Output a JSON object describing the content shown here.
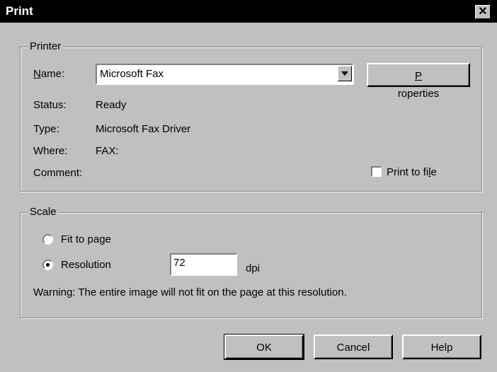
{
  "dialog": {
    "title": "Print",
    "close_glyph": "✕"
  },
  "printer_group": {
    "legend": "Printer",
    "name_label_accel": "N",
    "name_label_rest": "ame:",
    "name_value": "Microsoft Fax",
    "properties_label_accel": "P",
    "properties_label_rest": "roperties",
    "status_label": "Status:",
    "status_value": "Ready",
    "type_label": "Type:",
    "type_value": "Microsoft Fax Driver",
    "where_label": "Where:",
    "where_value": "FAX:",
    "comment_label": "Comment:",
    "print_to_file_pre": "Print to fi",
    "print_to_file_accel": "l",
    "print_to_file_post": "e",
    "print_to_file_checked": false
  },
  "scale_group": {
    "legend": "Scale",
    "fit_to_page_label": "Fit to page",
    "fit_to_page_selected": false,
    "resolution_label": "Resolution",
    "resolution_selected": true,
    "resolution_value": "72",
    "resolution_unit": "dpi",
    "warning": "Warning: The entire image will not fit on the page at this resolution."
  },
  "buttons": {
    "ok": "OK",
    "cancel": "Cancel",
    "help": "Help"
  }
}
